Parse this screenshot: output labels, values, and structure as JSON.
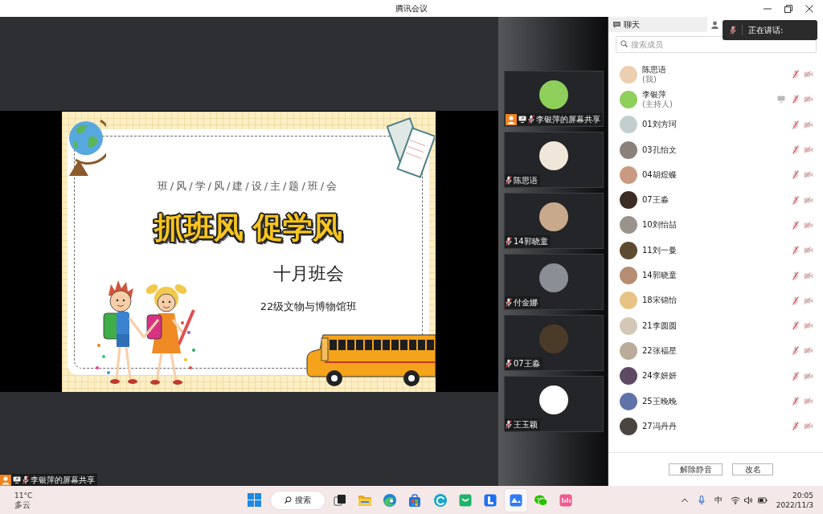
{
  "window": {
    "title": "腾讯会议"
  },
  "share": {
    "label": "李银萍的屏幕共享",
    "muted": true,
    "slide": {
      "subtitle": "班/风/学/风/建/设/主/题/班/会",
      "title": "抓班风 促学风",
      "heading": "十月班会",
      "class_name": "22级文物与博物馆班"
    }
  },
  "video_tiles": [
    {
      "name": "李银萍的屏幕共享",
      "sharing": true,
      "muted": true
    },
    {
      "name": "陈思语",
      "sharing": false,
      "muted": true
    },
    {
      "name": "14郭晓童",
      "sharing": false,
      "muted": true
    },
    {
      "name": "付金娜",
      "sharing": false,
      "muted": true
    },
    {
      "name": "07王淼",
      "sharing": false,
      "muted": true
    },
    {
      "name": "王玉颖",
      "sharing": false,
      "muted": true
    }
  ],
  "panel": {
    "tabs": [
      {
        "kind": "chat",
        "label": "聊天",
        "selected": false
      },
      {
        "kind": "members",
        "selected": true
      }
    ],
    "speaking_tooltip": {
      "label": "正在讲话:"
    },
    "search": {
      "placeholder": "搜索成员"
    },
    "members": [
      {
        "name": "陈思语",
        "role": "(我)",
        "sharing": false,
        "muted": true,
        "camera_off": true
      },
      {
        "name": "李银萍",
        "role": "(主持人)",
        "sharing": true,
        "muted": true,
        "camera_off": true
      },
      {
        "name": "01刘方珂",
        "sharing": false,
        "muted": true,
        "camera_off": true
      },
      {
        "name": "03孔怡文",
        "sharing": false,
        "muted": true,
        "camera_off": true
      },
      {
        "name": "04胡煜蝶",
        "sharing": false,
        "muted": true,
        "camera_off": true
      },
      {
        "name": "07王淼",
        "sharing": false,
        "muted": true,
        "camera_off": true
      },
      {
        "name": "10刘怡喆",
        "sharing": false,
        "muted": true,
        "camera_off": true
      },
      {
        "name": "11刘一曼",
        "sharing": false,
        "muted": true,
        "camera_off": true
      },
      {
        "name": "14郭晓童",
        "sharing": false,
        "muted": true,
        "camera_off": true
      },
      {
        "name": "18宋锦怡",
        "sharing": false,
        "muted": true,
        "camera_off": true
      },
      {
        "name": "21李圆圆",
        "sharing": false,
        "muted": true,
        "camera_off": true
      },
      {
        "name": "22张福星",
        "sharing": false,
        "muted": true,
        "camera_off": true
      },
      {
        "name": "24李妍妍",
        "sharing": false,
        "muted": true,
        "camera_off": true
      },
      {
        "name": "25王晚晚",
        "sharing": false,
        "muted": true,
        "camera_off": true
      },
      {
        "name": "27冯丹丹",
        "sharing": false,
        "muted": true,
        "camera_off": true
      }
    ],
    "buttons": [
      {
        "label": "解除静音"
      },
      {
        "label": "改名"
      }
    ]
  },
  "taskbar": {
    "weather": {
      "temperature": "11°C",
      "condition": "多云"
    },
    "search": {
      "label": "搜索"
    },
    "apps": [
      {
        "kind": "task_view",
        "selected": false
      },
      {
        "kind": "files",
        "selected": false
      },
      {
        "kind": "browser",
        "selected": false
      },
      {
        "kind": "store",
        "selected": false
      },
      {
        "kind": "circle_app",
        "selected": false
      },
      {
        "kind": "bag_app",
        "selected": false
      },
      {
        "kind": "tile_app",
        "selected": false
      },
      {
        "kind": "meeting",
        "selected": true
      },
      {
        "kind": "chat_app",
        "selected": false
      },
      {
        "kind": "pink_app",
        "selected": false
      }
    ],
    "tray": {
      "input_method": "中",
      "time": "20:05",
      "date": "2022/11/3"
    }
  }
}
